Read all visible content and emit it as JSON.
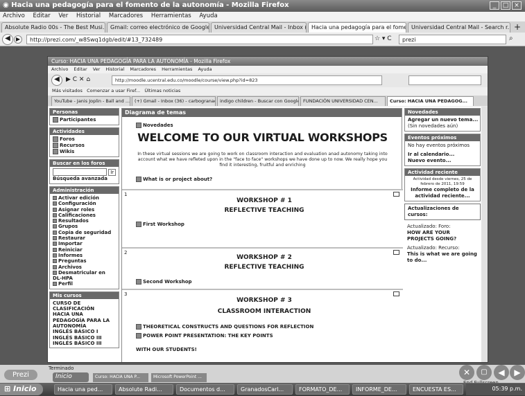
{
  "browser": {
    "title": "Hacia una pedagogía para el fomento de la autonomía - Mozilla Firefox",
    "menu": [
      "Archivo",
      "Editar",
      "Ver",
      "Historial",
      "Marcadores",
      "Herramientas",
      "Ayuda"
    ],
    "tabs": [
      "Absolute Radio 00s - The Best Musi...",
      "Gmail: correo electrónico de Google",
      "Universidad Central Mail - Inbox (1...",
      "Hacia una pedagogía para el fomen...",
      "Universidad Central Mail - Search r..."
    ],
    "url": "http://prezi.com/_w8Swq1dgb/edit/#13_732489",
    "search": "prezi"
  },
  "inner": {
    "title": "Curso: HACIA UNA PEDAGOGÍA PARA LA AUTONOMÍA - Mozilla Firefox",
    "menu": [
      "Archivo",
      "Editar",
      "Ver",
      "Historial",
      "Marcadores",
      "Herramientas",
      "Ayuda"
    ],
    "url": "http://moodle.ucentral.edu.co/moodle/course/view.php?id=823",
    "bookmarks": [
      "Más visitados",
      "Comenzar a usar Firef...",
      "Últimas noticias"
    ],
    "tabs": [
      "YouTube - Janis Joplin - Ball and ...",
      "(+) Gmail - Inbox (36) - carbogranado...",
      "indigo children - Buscar con Google",
      "FUNDACIÓN UNIVERSIDAD CEN...",
      "Curso: HACIA UNA PEDAGOG..."
    ]
  },
  "left": {
    "personas_h": "Personas",
    "participantes": "Participantes",
    "actividades_h": "Actividades",
    "actividades": [
      "Foros",
      "Recursos",
      "Wikis"
    ],
    "buscar_h": "Buscar en los foros",
    "ir": "Ir",
    "avanzada": "Búsqueda avanzada",
    "admin_h": "Administración",
    "admin": [
      "Activar edición",
      "Configuración",
      "Asignar roles",
      "Calificaciones",
      "Resultados",
      "Grupos",
      "Copia de seguridad",
      "Restaurar",
      "Importar",
      "Reiniciar",
      "Informes",
      "Preguntas",
      "Archivos",
      "Desmatricular en DL-HPA",
      "Perfil"
    ],
    "cursos_h": "Mis cursos",
    "cursos": [
      "CURSO DE CLASIFICACIÓN",
      "HACIA UNA PEDAGOGÍA PARA LA AUTONOMÍA",
      "INGLÉS BÁSICO I",
      "INGLÉS BÁSICO III",
      "INGLÉS BÁSICO III"
    ]
  },
  "main": {
    "header": "Diagrama de temas",
    "novedades": "Novedades",
    "welcome": "WELCOME TO OUR VIRTUAL WORKSHOPS",
    "intro": "In these virtual sessions we are going to work on classroom interaction and evaluation anad autonomy taking into account what we have refleted upon in the \"face to face\" workshops we have done up to now. We really hope you find it interesting, fruitful and enriching",
    "about": "What is or project about?",
    "s1_num": "1",
    "s1_t1": "WORKSHOP # 1",
    "s1_t2": "REFLECTIVE TEACHING",
    "s1_res": "First Workshop",
    "s2_num": "2",
    "s2_t1": "WORKSHOP # 2",
    "s2_t2": "REFLECTIVE TEACHING",
    "s2_res": "Second Workshop",
    "s3_num": "3",
    "s3_t1": "WORKSHOP # 3",
    "s3_t2": "CLASSROOM INTERACTION",
    "s3_r1": "THEORETICAL CONSTRUCTS AND QUESTIONS FOR REFLECTION",
    "s3_r2": "POWER POINT PRESENTATION: THE KEY POINTS",
    "s3_r3": "WITH OUR STUDENTS!"
  },
  "right": {
    "nov_h": "Novedades",
    "nov_link": "Agregar un nuevo tema...",
    "nov_none": "(Sin novedades aún)",
    "ev_h": "Eventos próximos",
    "ev_none": "No hay eventos próximos",
    "ev_cal": "Ir al calendario...",
    "ev_new": "Nuevo evento...",
    "act_h": "Actividad reciente",
    "act_since": "Actividad desde viernes, 25 de febrero de 2011, 19:59",
    "act_report": "Informe completo de la actividad reciente...",
    "upd_h": "Actualizaciones de cursos:",
    "upd1_l": "Actualizado: Foro:",
    "upd1": "HOW ARE YOUR PROJECTS GOING?",
    "upd2_l": "Actualizado: Recurso:",
    "upd2": "This is what we are going to do..."
  },
  "status": {
    "text": "Terminado",
    "prezi": "Prezi",
    "end": "End Fullscreen"
  },
  "taskbar": {
    "inner_start": "Inicio",
    "inner_items": [
      "Curso: HACIA UNA P...",
      "Microsoft PowerPoint ..."
    ],
    "start": "Inicio",
    "items": [
      "Hacia una ped...",
      "Absolute Radi...",
      "Documentos d...",
      "GranadosCarl...",
      "FORMATO_DE...",
      "INFORME_DE...",
      "ENCUESTA ES..."
    ],
    "clock": "05:39 p.m."
  }
}
